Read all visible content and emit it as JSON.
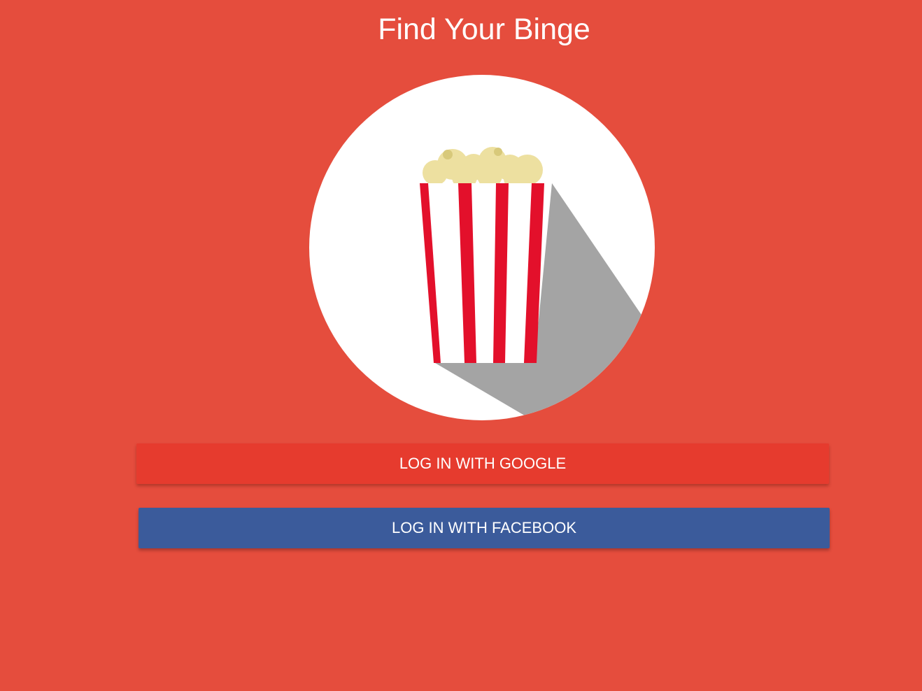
{
  "app": {
    "title": "Find Your Binge"
  },
  "logo": {
    "icon": "popcorn-icon"
  },
  "auth": {
    "google_label": "LOG IN WITH GOOGLE",
    "facebook_label": "LOG IN WITH FACEBOOK"
  },
  "colors": {
    "background": "#e54d3d",
    "google_button": "#e63b2e",
    "facebook_button": "#3b5b9b",
    "circle": "#ffffff",
    "stripe_red": "#e3102b",
    "popcorn": "#ede0a0",
    "shadow": "#a4a4a4"
  }
}
